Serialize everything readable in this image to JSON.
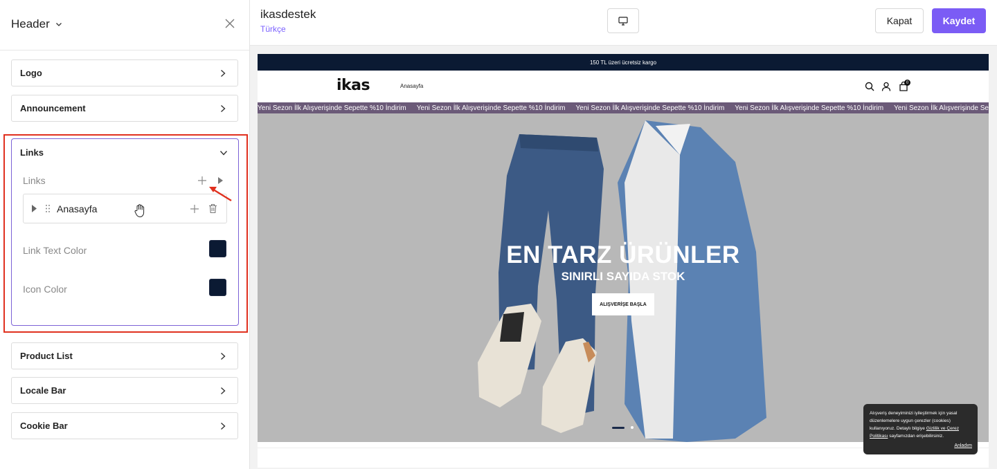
{
  "sidebar": {
    "title": "Header",
    "sections": [
      {
        "label": "Logo"
      },
      {
        "label": "Announcement"
      },
      {
        "label": "Links"
      },
      {
        "label": "Product List"
      },
      {
        "label": "Locale Bar"
      },
      {
        "label": "Cookie Bar"
      }
    ],
    "links_panel": {
      "list_label": "Links",
      "item_label": "Anasayfa",
      "link_text_color_label": "Link Text Color",
      "icon_color_label": "Icon Color",
      "link_text_color": "#0b1a33",
      "icon_color": "#0b1a33"
    }
  },
  "topbar": {
    "store_name": "ikasdestek",
    "language": "Türkçe",
    "close_label": "Kapat",
    "save_label": "Kaydet"
  },
  "preview": {
    "announcement": "150 TL üzeri ücretsiz kargo",
    "logo": "ikas",
    "nav_link": "Anasayfa",
    "cart_count": "0",
    "marquee_text": "Yeni Sezon İlk Alışverişinde Sepette %10 İndirim",
    "hero_title": "EN TARZ ÜRÜNLER",
    "hero_subtitle": "SINIRLI SAYIDA STOK",
    "hero_cta": "ALIŞVERİŞE BAŞLA",
    "cookie_text_1": "Alışveriş deneyiminizi iyileştirmek için yasal düzenlemelere uygun çerezler (cookies) kullanıyoruz. Detaylı bilgiye",
    "cookie_link": "Gizlilik ve Çerez Politikası",
    "cookie_text_2": "sayfamızdan erişebilirsiniz.",
    "cookie_ok": "Anladım"
  },
  "colors": {
    "accent": "#7b5cf5",
    "navy": "#0b1a33",
    "highlight_red": "#e0301e",
    "marquee_bg": "#6b5a78"
  }
}
